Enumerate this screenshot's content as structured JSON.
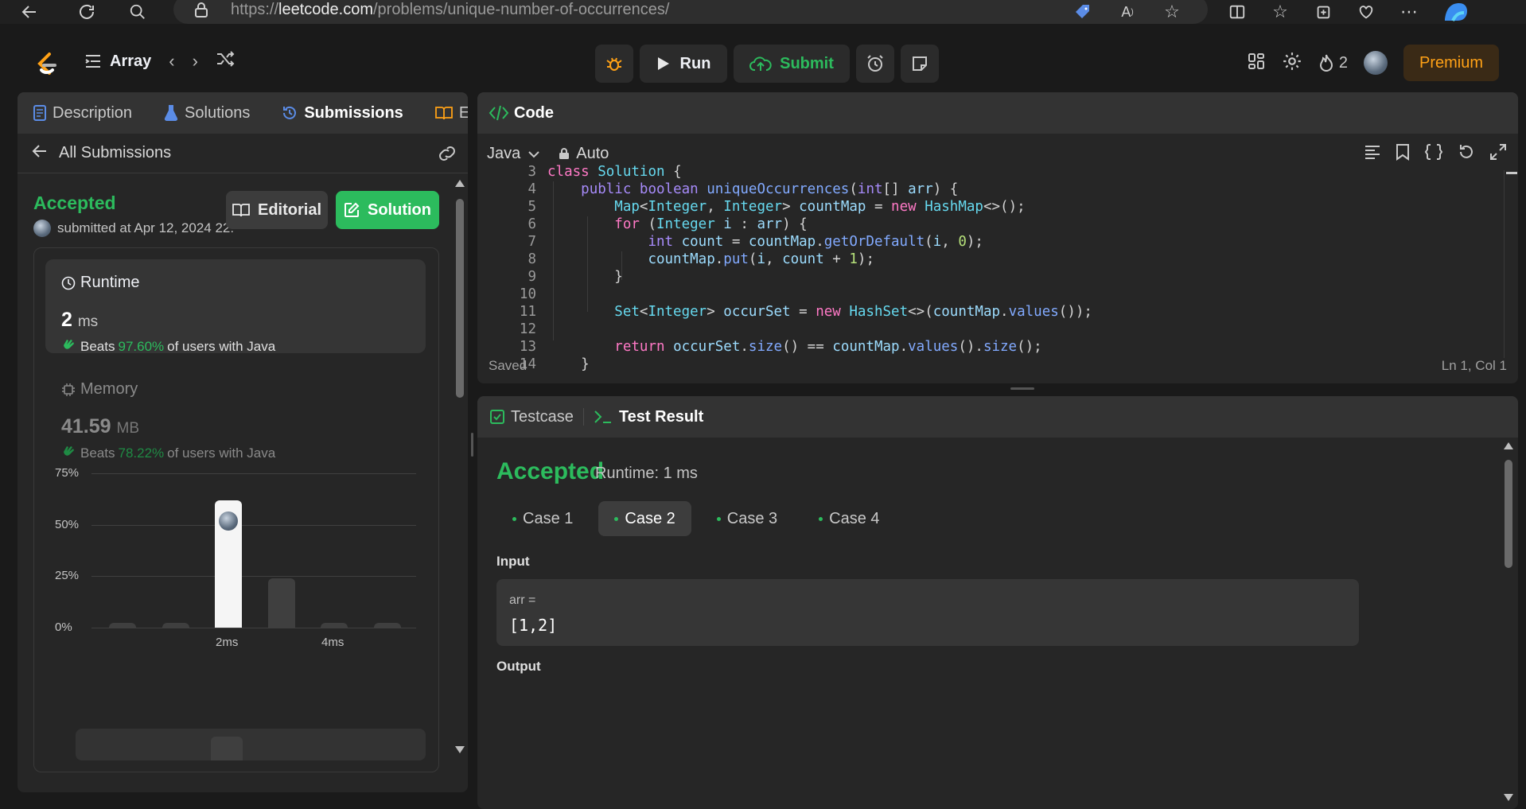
{
  "browser": {
    "url_scheme": "https://",
    "url_host": "leetcode.com",
    "url_path": "/problems/unique-number-of-occurrences/"
  },
  "topnav": {
    "problem_list": "Array",
    "run_label": "Run",
    "submit_label": "Submit",
    "streak_count": "2",
    "premium_label": "Premium"
  },
  "left_tabs": [
    "Description",
    "Solutions",
    "Submissions",
    "Editorial"
  ],
  "submission": {
    "back_label": "All Submissions",
    "status": "Accepted",
    "submitted_text": "submitted at Apr 12, 2024 22:",
    "editorial_button": "Editorial",
    "solution_button": "Solution",
    "runtime": {
      "label": "Runtime",
      "value": "2",
      "unit": "ms",
      "beats_prefix": "Beats",
      "beats_pct": "97.60%",
      "beats_suffix": "of users with Java"
    },
    "memory": {
      "label": "Memory",
      "value": "41.59",
      "unit": "MB",
      "beats_prefix": "Beats",
      "beats_pct": "78.22%",
      "beats_suffix": "of users with Java"
    }
  },
  "chart_data": {
    "type": "bar",
    "yticks": [
      "75%",
      "50%",
      "25%",
      "0%"
    ],
    "ylim": [
      0,
      75
    ],
    "xticks": [
      "2ms",
      "4ms"
    ],
    "bars": [
      {
        "value": 2,
        "highlight": false
      },
      {
        "value": 2,
        "highlight": false
      },
      {
        "value": 62,
        "highlight": true
      },
      {
        "value": 24,
        "highlight": false
      },
      {
        "value": 2,
        "highlight": false
      },
      {
        "value": 2,
        "highlight": false
      }
    ]
  },
  "code_panel": {
    "title": "Code",
    "language": "Java",
    "mode": "Auto",
    "status": "Saved",
    "cursor": "Ln 1, Col 1",
    "line_numbers": [
      "3",
      "4",
      "5",
      "6",
      "7",
      "8",
      "9",
      "10",
      "11",
      "12",
      "13",
      "14"
    ]
  },
  "test_panel": {
    "tab_testcase": "Testcase",
    "tab_result": "Test Result",
    "status": "Accepted",
    "runtime": "Runtime: 1 ms",
    "cases": [
      "Case 1",
      "Case 2",
      "Case 3",
      "Case 4"
    ],
    "active_case": 1,
    "input_label": "Input",
    "input_var": "arr =",
    "input_value": "[1,2]",
    "output_label": "Output"
  },
  "colors": {
    "accent_green": "#2cbb5d",
    "premium_orange": "#ffa116"
  }
}
